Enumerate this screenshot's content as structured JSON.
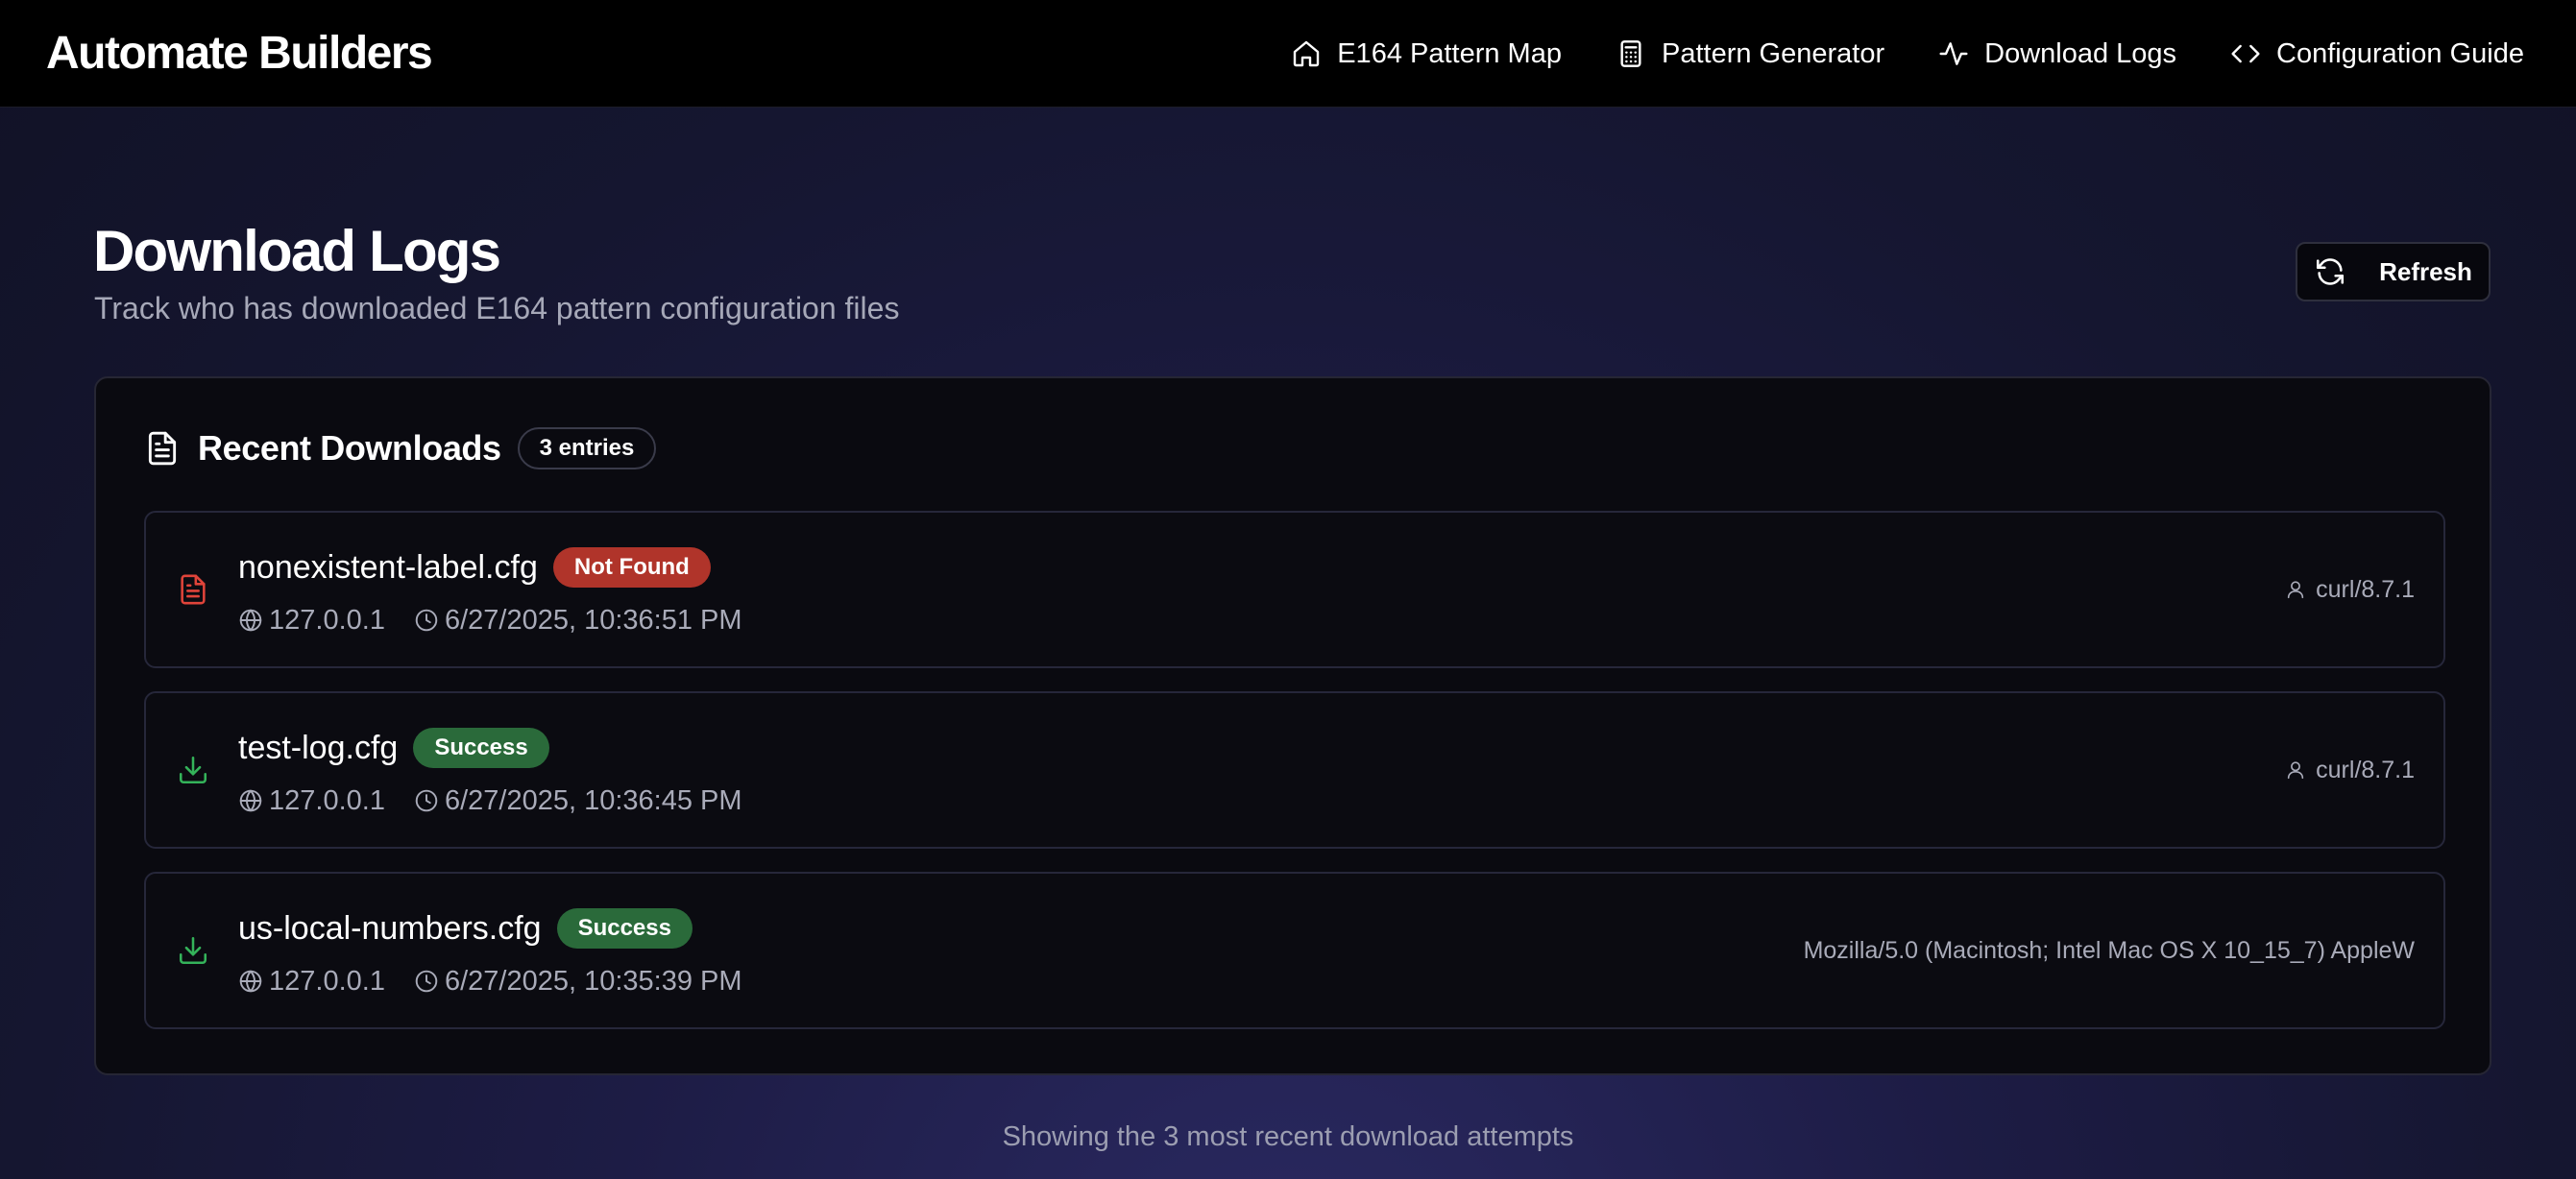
{
  "app": {
    "title": "Automate Builders"
  },
  "nav": {
    "items": [
      {
        "label": "E164 Pattern Map",
        "icon": "home-icon"
      },
      {
        "label": "Pattern Generator",
        "icon": "calculator-icon"
      },
      {
        "label": "Download Logs",
        "icon": "activity-icon"
      },
      {
        "label": "Configuration Guide",
        "icon": "code-icon"
      }
    ]
  },
  "page": {
    "title": "Download Logs",
    "subtitle": "Track who has downloaded E164 pattern configuration files",
    "refresh_label": "Refresh"
  },
  "card": {
    "title": "Recent Downloads",
    "count_label": "3 entries",
    "icon": "file-text-icon"
  },
  "downloads": [
    {
      "filename": "nonexistent-label.cfg",
      "status": "Not Found",
      "ip": "127.0.0.1",
      "timestamp": "6/27/2025, 10:36:51 PM",
      "user_agent": "curl/8.7.1",
      "icon": "file-text-icon"
    },
    {
      "filename": "test-log.cfg",
      "status": "Success",
      "ip": "127.0.0.1",
      "timestamp": "6/27/2025, 10:36:45 PM",
      "user_agent": "curl/8.7.1",
      "icon": "download-icon"
    },
    {
      "filename": "us-local-numbers.cfg",
      "status": "Success",
      "ip": "127.0.0.1",
      "timestamp": "6/27/2025, 10:35:39 PM",
      "user_agent": "Mozilla/5.0 (Macintosh; Intel Mac OS X 10_15_7) AppleW",
      "icon": "download-icon"
    }
  ],
  "footer": {
    "note": "Showing the 3 most recent download attempts"
  },
  "colors": {
    "not_found": "#b0342a",
    "success": "#2a6a3a",
    "error_icon": "#e0443a",
    "success_icon": "#34b35a"
  }
}
